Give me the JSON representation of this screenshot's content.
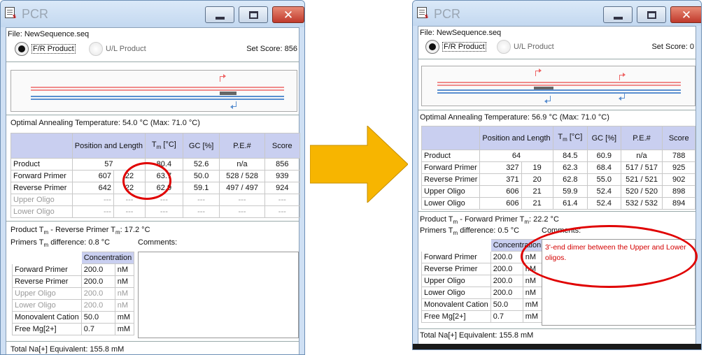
{
  "app_title": "PCR",
  "file_label": "File: NewSequence.seq",
  "radio": {
    "fr": "F/R Product",
    "ul": "U/L Product"
  },
  "columns": {
    "pos": "Position and Length",
    "tm": "T",
    "tm_sub": "m",
    "tm_unit": " [°C]",
    "gc": "GC [%]",
    "pe": "P.E.#",
    "score": "Score"
  },
  "conc_header": "Concentration",
  "comments_label": "Comments:",
  "left": {
    "set_score": "Set Score: 856",
    "annealing": "Optimal Annealing Temperature: 54.0 °C (Max: 71.0 °C)",
    "rows": [
      {
        "name": "Product",
        "pos": "57",
        "len": "",
        "tm": "80.4",
        "gc": "52.6",
        "pe": "n/a",
        "score": "856"
      },
      {
        "name": "Forward Primer",
        "pos": "607",
        "len": "22",
        "tm": "63.7",
        "gc": "50.0",
        "pe": "528 / 528",
        "score": "939"
      },
      {
        "name": "Reverse Primer",
        "pos": "642",
        "len": "22",
        "tm": "62.9",
        "gc": "59.1",
        "pe": "497 / 497",
        "score": "924"
      },
      {
        "name": "Upper Oligo",
        "pos": "---",
        "len": "---",
        "tm": "---",
        "gc": "---",
        "pe": "---",
        "score": "---"
      },
      {
        "name": "Lower Oligo",
        "pos": "---",
        "len": "---",
        "tm": "---",
        "gc": "---",
        "pe": "---",
        "score": "---"
      }
    ],
    "diff1_pre": "Product T",
    "diff1_sub": "m",
    "diff1_mid": " - Reverse Primer T",
    "diff1_sub2": "m",
    "diff1_post": ": 17.2 °C",
    "diff2_pre": "Primers T",
    "diff2_sub": "m",
    "diff2_post": " difference: 0.8 °C",
    "conc": [
      {
        "name": "Forward Primer",
        "value": "200.0",
        "unit": "nM"
      },
      {
        "name": "Reverse Primer",
        "value": "200.0",
        "unit": "nM"
      },
      {
        "name": "Upper Oligo",
        "value": "200.0",
        "unit": "nM"
      },
      {
        "name": "Lower Oligo",
        "value": "200.0",
        "unit": "nM"
      },
      {
        "name": "Monovalent Cation",
        "value": "50.0",
        "unit": "mM"
      },
      {
        "name": "Free Mg[2+]",
        "value": "0.7",
        "unit": "mM"
      }
    ],
    "total": "Total Na[+] Equivalent: 155.8 mM",
    "comment": ""
  },
  "right": {
    "set_score": "Set Score: 0",
    "annealing": "Optimal Annealing Temperature: 56.9 °C (Max: 71.0 °C)",
    "rows": [
      {
        "name": "Product",
        "pos": "64",
        "len": "",
        "tm": "84.5",
        "gc": "60.9",
        "pe": "n/a",
        "score": "788"
      },
      {
        "name": "Forward Primer",
        "pos": "327",
        "len": "19",
        "tm": "62.3",
        "gc": "68.4",
        "pe": "517 / 517",
        "score": "925"
      },
      {
        "name": "Reverse Primer",
        "pos": "371",
        "len": "20",
        "tm": "62.8",
        "gc": "55.0",
        "pe": "521 / 521",
        "score": "902"
      },
      {
        "name": "Upper Oligo",
        "pos": "606",
        "len": "21",
        "tm": "59.9",
        "gc": "52.4",
        "pe": "520 / 520",
        "score": "898"
      },
      {
        "name": "Lower Oligo",
        "pos": "606",
        "len": "21",
        "tm": "61.4",
        "gc": "52.4",
        "pe": "532 / 532",
        "score": "894"
      }
    ],
    "diff1_pre": "Product T",
    "diff1_sub": "m",
    "diff1_mid": " - Forward Primer T",
    "diff1_sub2": "m",
    "diff1_post": ": 22.2 °C",
    "diff2_pre": "Primers T",
    "diff2_sub": "m",
    "diff2_post": " difference: 0.5 °C",
    "conc": [
      {
        "name": "Forward Primer",
        "value": "200.0",
        "unit": "nM"
      },
      {
        "name": "Reverse Primer",
        "value": "200.0",
        "unit": "nM"
      },
      {
        "name": "Upper Oligo",
        "value": "200.0",
        "unit": "nM"
      },
      {
        "name": "Lower Oligo",
        "value": "200.0",
        "unit": "nM"
      },
      {
        "name": "Monovalent Cation",
        "value": "50.0",
        "unit": "mM"
      },
      {
        "name": "Free Mg[2+]",
        "value": "0.7",
        "unit": "mM"
      }
    ],
    "total": "Total Na[+] Equivalent: 155.8 mM",
    "comment": "3'-end dimer between the Upper and Lower oligos."
  },
  "colors": {
    "accent": "#c9cff0",
    "highlight": "#e00000",
    "arrow": "#f7b500",
    "comment": "#d40000"
  }
}
